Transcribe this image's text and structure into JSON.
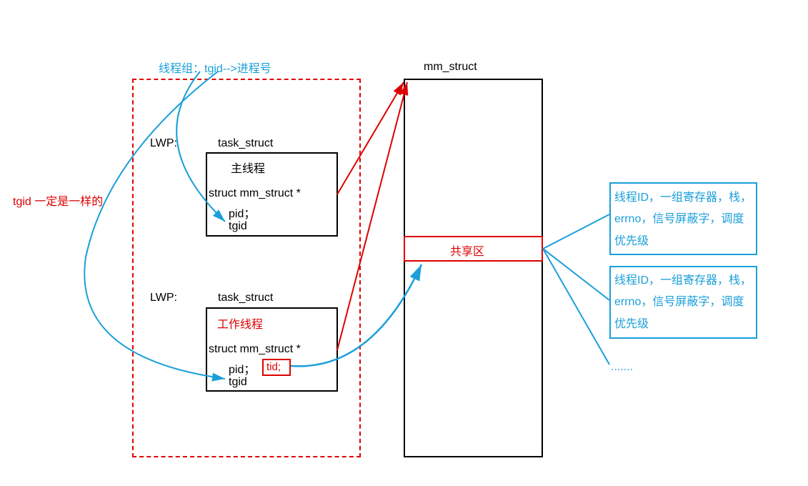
{
  "labels": {
    "threadGroup": "线程组：tgid-->进程号",
    "mmStructTitle": "mm_struct",
    "tgidSame": "tgid 一定是一样的",
    "lwp1": "LWP:",
    "lwp2": "LWP:",
    "taskStruct1": "task_struct",
    "taskStruct2": "task_struct",
    "mainThread": "主线程",
    "workThread": "工作线程",
    "mmStructPtr1": "struct mm_struct *",
    "mmStructPtr2": "struct mm_struct *",
    "pid1": "pid；",
    "pid2": "pid；",
    "tgid1": "tgid",
    "tgid2": "tgid",
    "tid": "tid;",
    "sharedArea": "共享区",
    "threadAttr1": "线程ID，一组寄存器，栈，errno，信号屏蔽字，调度优先级",
    "threadAttr2": "线程ID，一组寄存器，栈，errno，信号屏蔽字，调度优先级",
    "ellipsis": "......."
  },
  "colors": {
    "black": "#000000",
    "red": "#d00000",
    "blue": "#1a9fd9"
  }
}
